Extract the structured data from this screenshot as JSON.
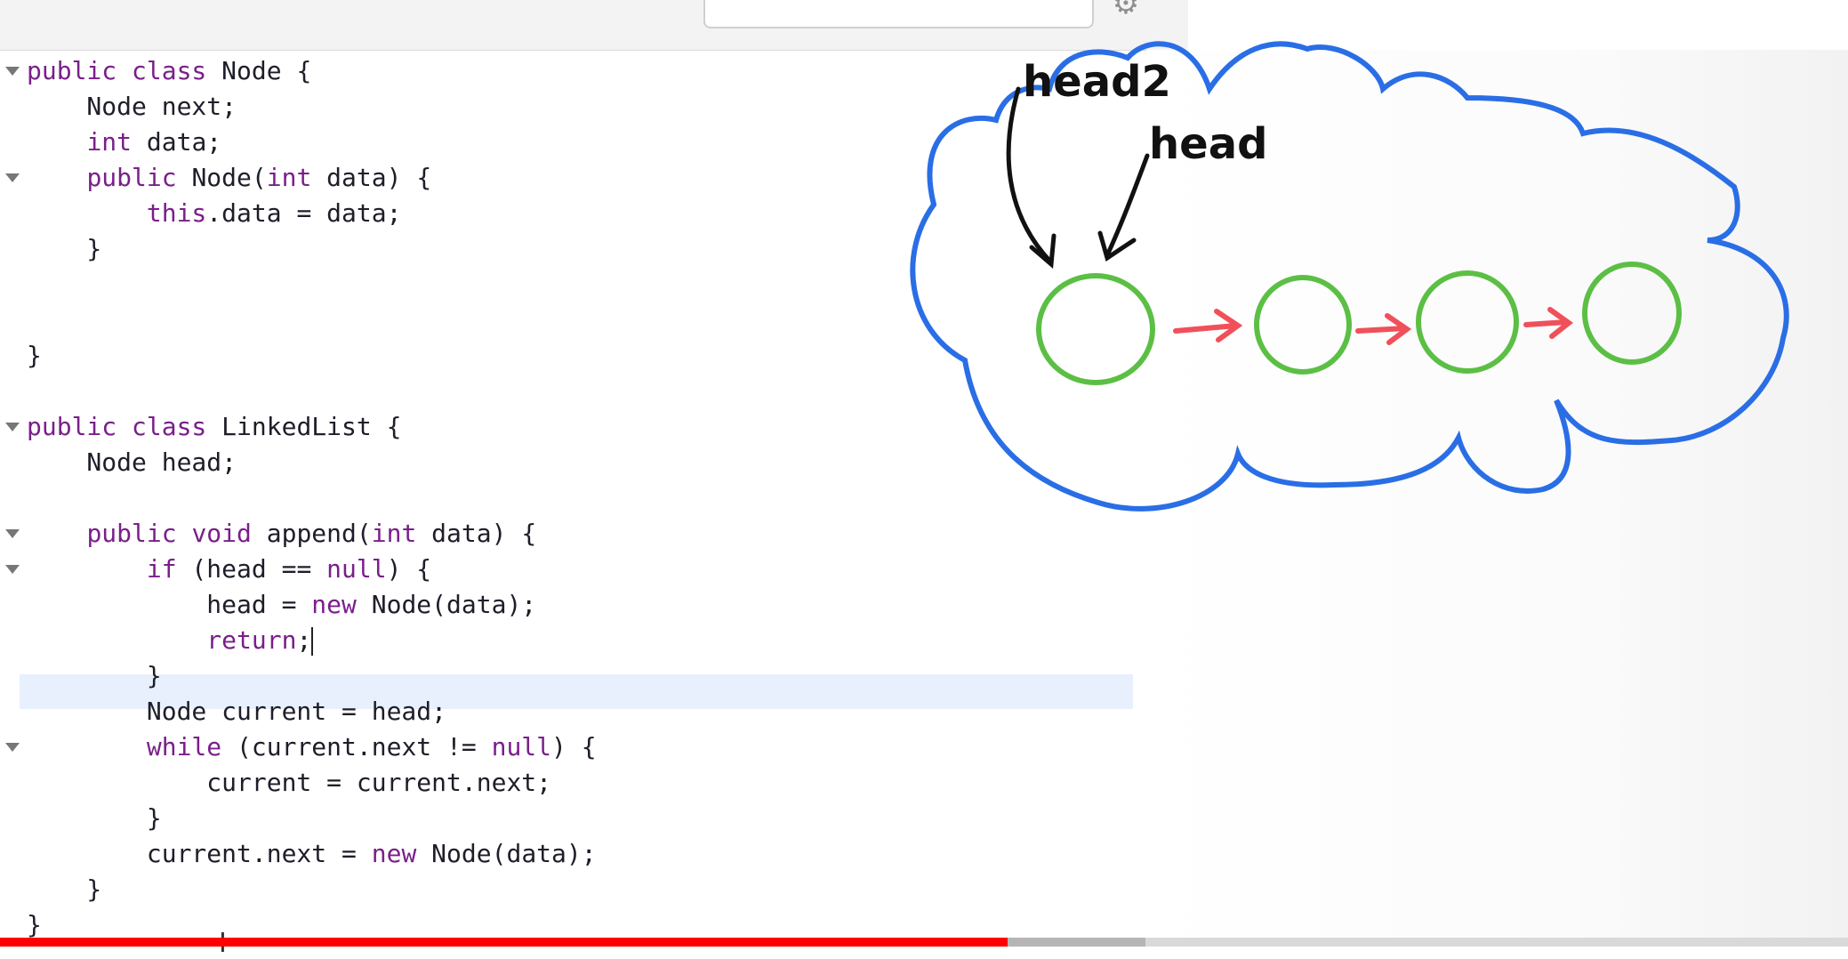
{
  "code_lines": [
    {
      "fold": true,
      "parts": [
        {
          "t": "public class",
          "k": true
        },
        {
          "t": " Node {"
        }
      ]
    },
    {
      "fold": false,
      "parts": [
        {
          "t": "    Node next;"
        }
      ]
    },
    {
      "fold": false,
      "parts": [
        {
          "t": "    "
        },
        {
          "t": "int",
          "k": true
        },
        {
          "t": " data;"
        }
      ]
    },
    {
      "fold": true,
      "parts": [
        {
          "t": "    "
        },
        {
          "t": "public",
          "k": true
        },
        {
          "t": " Node("
        },
        {
          "t": "int",
          "k": true
        },
        {
          "t": " data) {"
        }
      ]
    },
    {
      "fold": false,
      "parts": [
        {
          "t": "        "
        },
        {
          "t": "this",
          "k": true
        },
        {
          "t": ".data = data;"
        }
      ]
    },
    {
      "fold": false,
      "parts": [
        {
          "t": "    }"
        }
      ]
    },
    {
      "fold": false,
      "parts": [
        {
          "t": ""
        }
      ]
    },
    {
      "fold": false,
      "parts": [
        {
          "t": ""
        }
      ]
    },
    {
      "fold": false,
      "parts": [
        {
          "t": "}"
        }
      ]
    },
    {
      "fold": false,
      "parts": [
        {
          "t": ""
        }
      ]
    },
    {
      "fold": true,
      "parts": [
        {
          "t": "public class",
          "k": true
        },
        {
          "t": " LinkedList {"
        }
      ]
    },
    {
      "fold": false,
      "parts": [
        {
          "t": "    Node head;"
        }
      ]
    },
    {
      "fold": false,
      "parts": [
        {
          "t": ""
        }
      ]
    },
    {
      "fold": true,
      "parts": [
        {
          "t": "    "
        },
        {
          "t": "public void",
          "k": true
        },
        {
          "t": " append("
        },
        {
          "t": "int",
          "k": true
        },
        {
          "t": " data) {"
        }
      ]
    },
    {
      "fold": true,
      "parts": [
        {
          "t": "        "
        },
        {
          "t": "if",
          "k": true
        },
        {
          "t": " (head == "
        },
        {
          "t": "null",
          "k": true
        },
        {
          "t": ") {"
        }
      ]
    },
    {
      "fold": false,
      "parts": [
        {
          "t": "            head = "
        },
        {
          "t": "new",
          "k": true
        },
        {
          "t": " Node(data);"
        }
      ]
    },
    {
      "fold": false,
      "parts": [
        {
          "t": "            "
        },
        {
          "t": "return",
          "k": true
        },
        {
          "t": ";"
        }
      ],
      "cursor": true
    },
    {
      "fold": false,
      "parts": [
        {
          "t": "        }"
        }
      ]
    },
    {
      "fold": false,
      "parts": [
        {
          "t": "        Node current = head;"
        }
      ]
    },
    {
      "fold": true,
      "parts": [
        {
          "t": "        "
        },
        {
          "t": "while",
          "k": true
        },
        {
          "t": " (current.next != "
        },
        {
          "t": "null",
          "k": true
        },
        {
          "t": ") {"
        }
      ]
    },
    {
      "fold": false,
      "parts": [
        {
          "t": "            current = current.next;"
        }
      ]
    },
    {
      "fold": false,
      "parts": [
        {
          "t": "        }"
        }
      ]
    },
    {
      "fold": false,
      "parts": [
        {
          "t": "        current.next = "
        },
        {
          "t": "new",
          "k": true
        },
        {
          "t": " Node(data);"
        }
      ]
    },
    {
      "fold": false,
      "parts": [
        {
          "t": "    }"
        }
      ]
    },
    {
      "fold": false,
      "parts": [
        {
          "t": "}"
        }
      ]
    }
  ],
  "diagram": {
    "labels": {
      "head2": "head2",
      "head": "head"
    },
    "node_count": 4,
    "colors": {
      "cloud": "#2a6ee6",
      "node": "#5cbf45",
      "arrow": "#f0505a",
      "pointer": "#111111"
    }
  },
  "progress": {
    "played_fraction": 0.545,
    "buffered_fraction": 0.62
  },
  "colors": {
    "keyword": "#7a1f8a",
    "text": "#1e1e2a",
    "highlight": "#e8f0fd",
    "progress": "#ff0000"
  }
}
